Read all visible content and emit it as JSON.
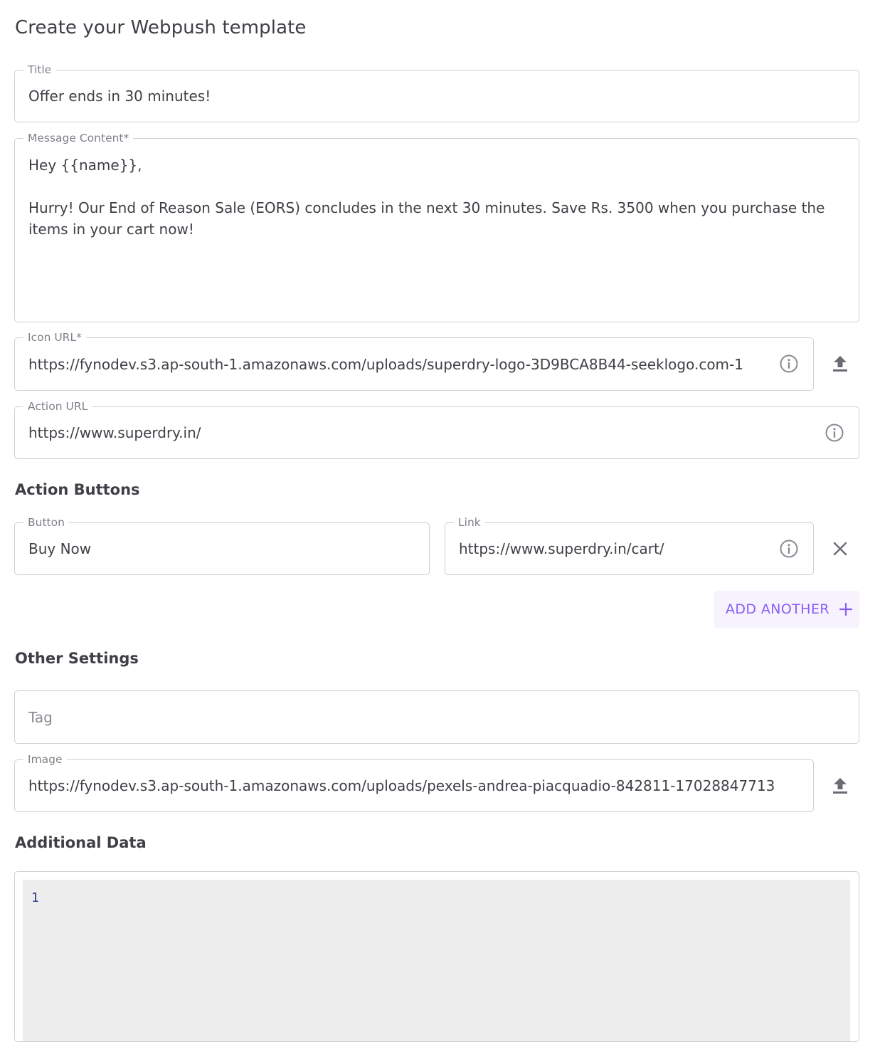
{
  "page": {
    "title": "Create your Webpush template"
  },
  "title_field": {
    "label": "Title",
    "value": "Offer ends in 30 minutes!"
  },
  "message_field": {
    "label": "Message Content*",
    "value": "Hey {{name}},\n\nHurry! Our End of Reason Sale (EORS) concludes in the next 30 minutes. Save Rs. 3500 when you purchase the items in your cart now!"
  },
  "icon_url_field": {
    "label": "Icon URL*",
    "value": "https://fynodev.s3.ap-south-1.amazonaws.com/uploads/superdry-logo-3D9BCA8B44-seeklogo.com-1"
  },
  "action_url_field": {
    "label": "Action URL",
    "value": "https://www.superdry.in/"
  },
  "action_buttons": {
    "heading": "Action Buttons",
    "button_label": "Button",
    "button_value": "Buy Now",
    "link_label": "Link",
    "link_value": "https://www.superdry.in/cart/",
    "add_another_label": "ADD ANOTHER"
  },
  "other_settings": {
    "heading": "Other Settings",
    "tag_placeholder": "Tag",
    "image_label": "Image",
    "image_value": "https://fynodev.s3.ap-south-1.amazonaws.com/uploads/pexels-andrea-piacquadio-842811-17028847713"
  },
  "additional_data": {
    "heading": "Additional Data",
    "line_number": "1"
  },
  "icons": {
    "info": "info-circle-icon",
    "upload": "upload-icon",
    "close": "close-icon",
    "plus": "plus-icon"
  },
  "colors": {
    "accent": "#8b5cf6",
    "accent_bg": "#f6f3fe",
    "border": "#cfcfd4",
    "text": "#3f3f46",
    "label": "#80808a",
    "editor_bg": "#ededed"
  }
}
